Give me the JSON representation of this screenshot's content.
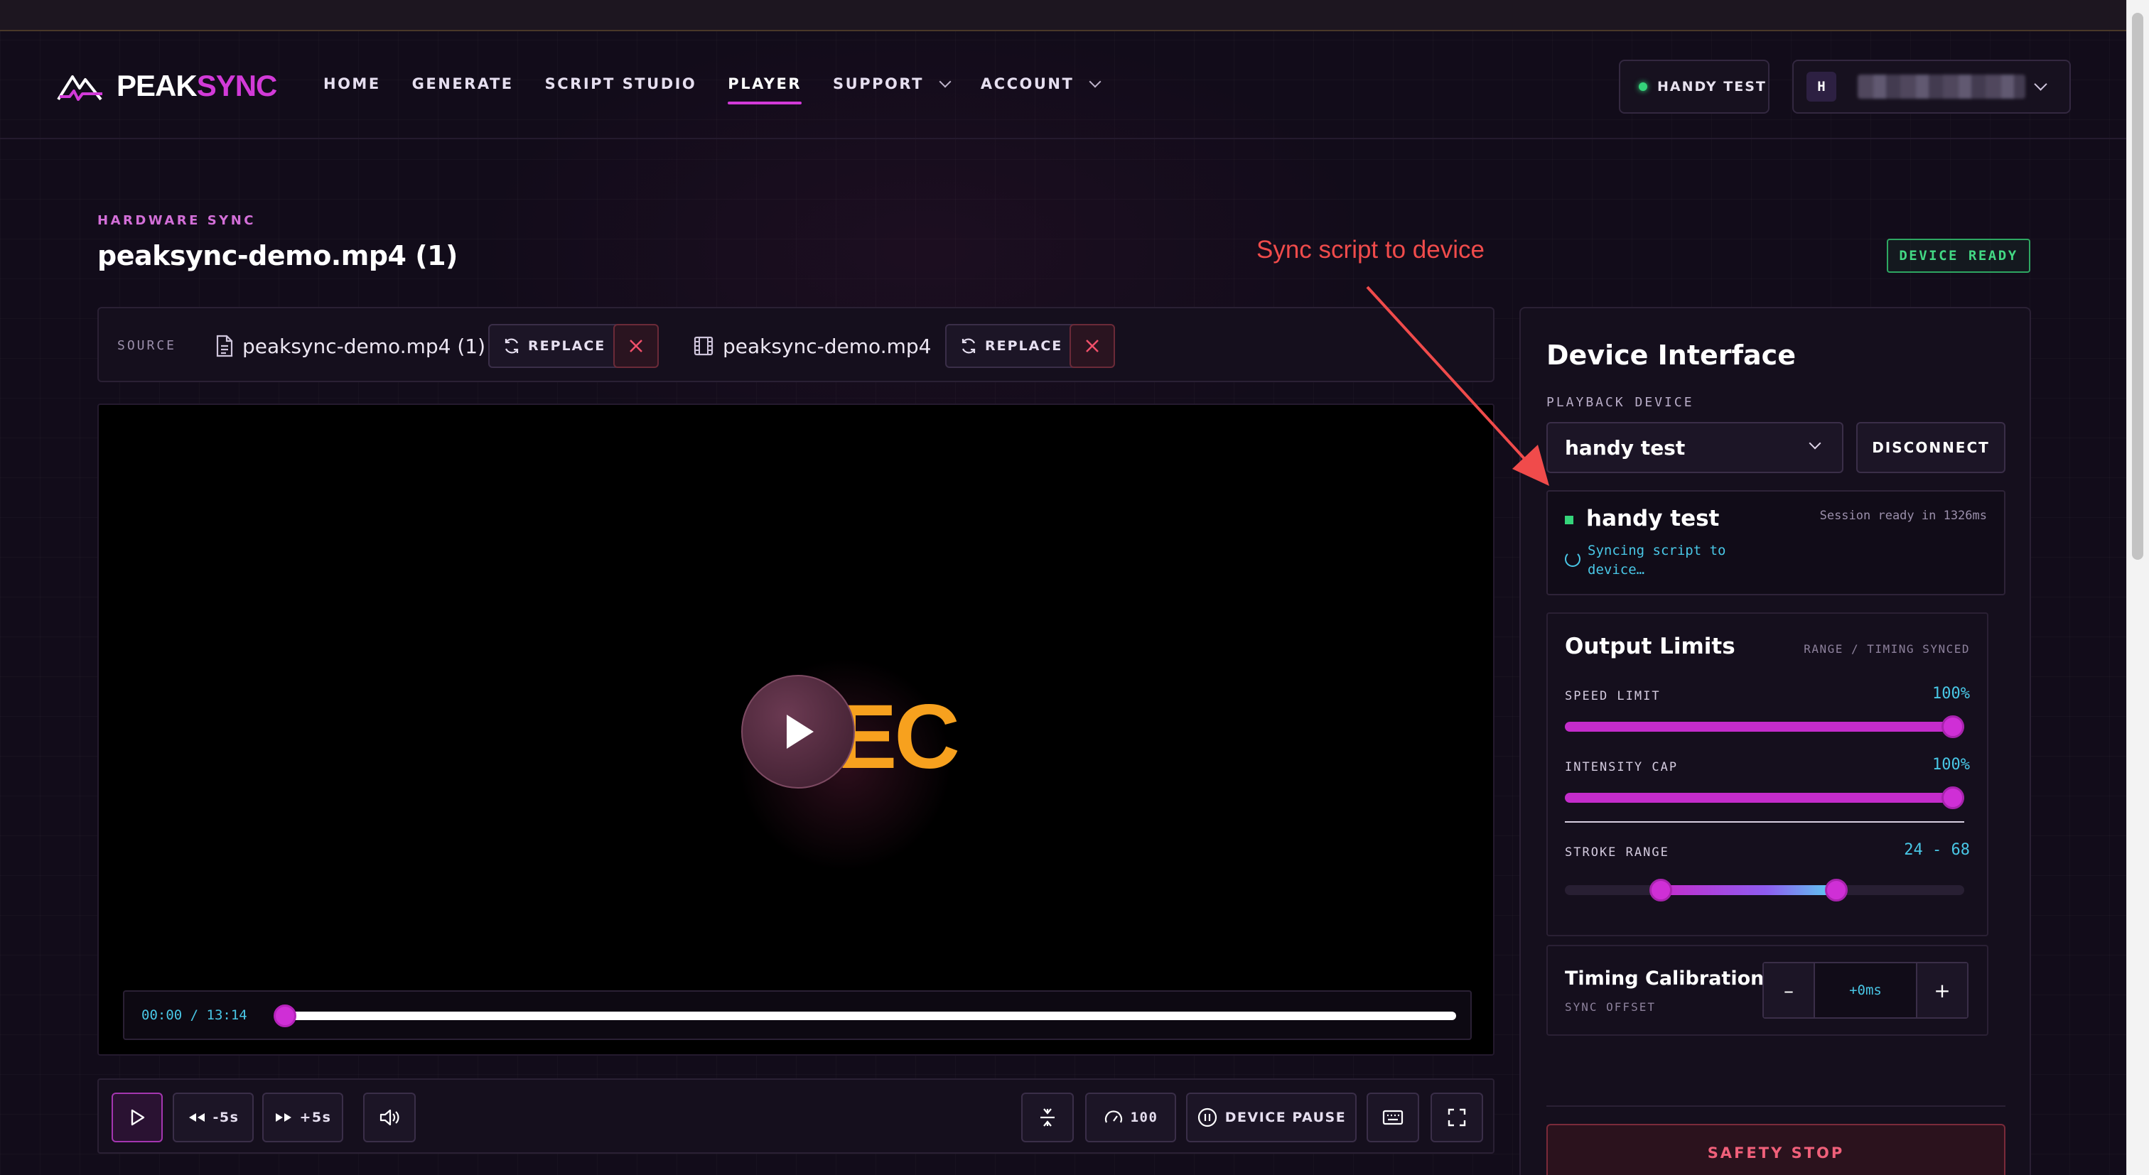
{
  "brand": {
    "name_a": "PEAK",
    "name_b": "SYNC",
    "accent": "#d23ad8"
  },
  "nav": {
    "home": "HOME",
    "generate": "GENERATE",
    "script_studio": "SCRIPT STUDIO",
    "player": "PLAYER",
    "support": "SUPPORT",
    "account": "ACCOUNT",
    "active": "PLAYER"
  },
  "header": {
    "device_pill": "HANDY TEST",
    "avatar_initial": "H"
  },
  "page": {
    "eyebrow": "HARDWARE SYNC",
    "title": "peaksync-demo.mp4 (1)",
    "status_badge": "DEVICE READY"
  },
  "annotation": {
    "text": "Sync script to device",
    "color": "#f04b4b"
  },
  "source": {
    "label": "SOURCE",
    "script_file": "peaksync-demo.mp4 (1)",
    "video_file": "peaksync-demo.mp4",
    "replace_label": "REPLACE",
    "script_icon": "file-text-icon",
    "video_icon": "film-icon"
  },
  "video": {
    "overlay_text": "EC",
    "current_time": "00:00",
    "duration": "13:14",
    "time_display": "00:00 / 13:14",
    "progress": 0.0
  },
  "controls": {
    "rewind": "-5s",
    "forward": "+5s",
    "speed": "100",
    "device_pause": "DEVICE PAUSE"
  },
  "device_panel": {
    "title": "Device Interface",
    "playback_label": "PLAYBACK DEVICE",
    "selected_device": "handy test",
    "disconnect": "DISCONNECT",
    "session": {
      "name": "handy test",
      "ready": "Session ready in 1326ms",
      "syncing": "Syncing script to device…"
    },
    "output_limits": {
      "title": "Output Limits",
      "tag": "RANGE / TIMING SYNCED",
      "speed_label": "SPEED LIMIT",
      "speed_value": "100%",
      "speed": 1.0,
      "intensity_label": "INTENSITY CAP",
      "intensity_value": "100%",
      "intensity": 1.0,
      "stroke_label": "STROKE RANGE",
      "stroke_value": "24 - 68",
      "stroke_min": 24,
      "stroke_max": 68
    },
    "timing": {
      "title": "Timing Calibration",
      "subtitle": "SYNC OFFSET",
      "minus": "–",
      "value": "+0ms",
      "plus": "+"
    },
    "safety_stop": "SAFETY STOP"
  }
}
